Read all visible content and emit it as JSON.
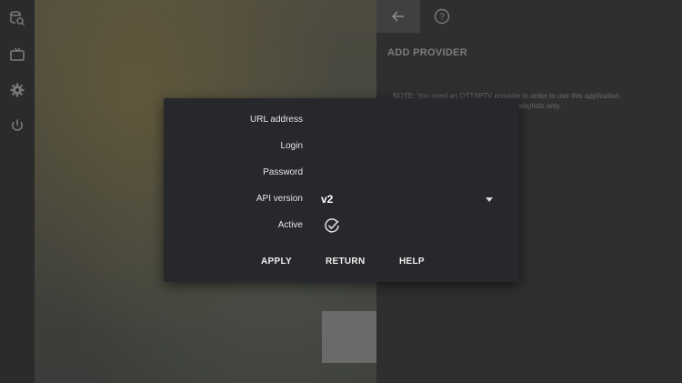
{
  "sidebar": {
    "icons": [
      "search-database-icon",
      "tv-icon",
      "gear-icon",
      "power-icon"
    ]
  },
  "right_panel": {
    "title": "ADD PROVIDER",
    "note": "NOTE: You need an OTT/IPTV provider in order to use this application.",
    "note_line2": "playlists only."
  },
  "dialog": {
    "fields": {
      "url_label": "URL address",
      "login_label": "Login",
      "password_label": "Password",
      "api_label": "API version",
      "api_value": "v2",
      "active_label": "Active"
    },
    "buttons": {
      "apply": "APPLY",
      "return": "RETURN",
      "help": "HELP"
    }
  },
  "colors": {
    "dialog_bg": "#26282b",
    "panel_bg": "#2f2f2f",
    "text": "#e6e6e6"
  }
}
